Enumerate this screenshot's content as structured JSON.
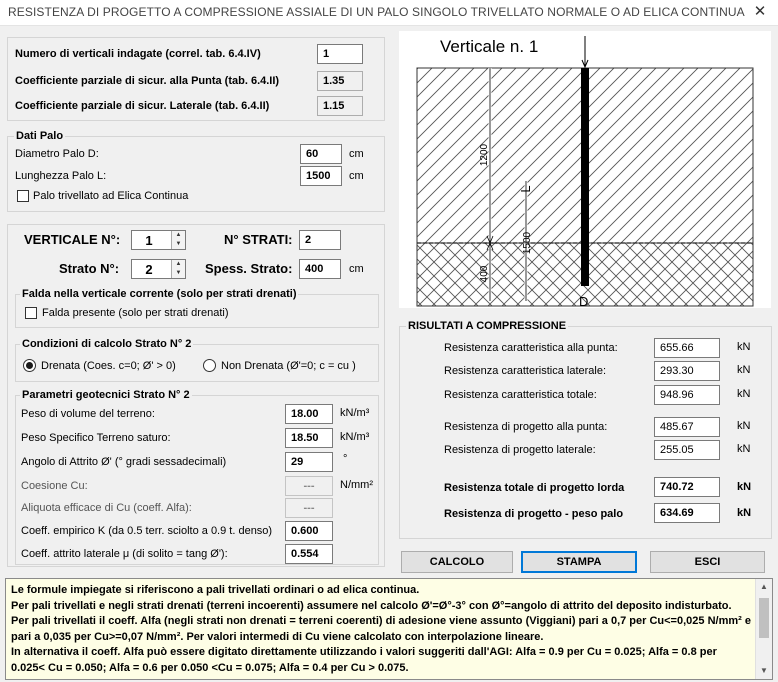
{
  "window": {
    "title": "RESISTENZA DI PROGETTO A COMPRESSIONE ASSIALE DI UN PALO SINGOLO TRIVELLATO NORMALE O AD ELICA CONTINUA",
    "close_glyph": "✕"
  },
  "general": {
    "n_verticali_label": "Numero di verticali indagate (correl. tab. 6.4.IV)",
    "n_verticali_value": "1",
    "coeff_punta_label": "Coefficiente parziale di sicur. alla Punta (tab. 6.4.II)",
    "coeff_punta_value": "1.35",
    "coeff_lat_label": "Coefficiente parziale di sicur.  Laterale (tab. 6.4.II)",
    "coeff_lat_value": "1.15"
  },
  "dati_palo": {
    "title": "Dati  Palo",
    "diametro_label": "Diametro Palo   D:",
    "diametro_value": "60",
    "diametro_unit": "cm",
    "lunghezza_label": "Lunghezza Palo   L:",
    "lunghezza_value": "1500",
    "lunghezza_unit": "cm",
    "elica_label": "Palo trivellato ad Elica Continua"
  },
  "strati": {
    "verticale_label": "VERTICALE  N°:",
    "verticale_value": "1",
    "n_strati_label": "N° STRATI:",
    "n_strati_value": "2",
    "strato_label": "Strato N°:",
    "strato_value": "2",
    "spess_label": "Spess. Strato:",
    "spess_value": "400",
    "spess_unit": "cm"
  },
  "falda": {
    "title": "Falda nella verticale corrente (solo per strati drenati)",
    "label": "Falda presente (solo per strati drenati)"
  },
  "condizioni": {
    "title": "Condizioni di calcolo Strato N° 2",
    "drenata_label": "Drenata    (Coes. c=0;  Ø' > 0)",
    "non_drenata_label": "Non Drenata  (Ø'=0;   c = cu )"
  },
  "parametri": {
    "title": "Parametri geotecnici Strato N° 2",
    "rows": [
      {
        "label": "Peso di volume del terreno:",
        "value": "18.00",
        "unit": "kN/m³"
      },
      {
        "label": "Peso Specifico Terreno saturo:",
        "value": "18.50",
        "unit": "kN/m³"
      },
      {
        "label": "Angolo di Attrito  Ø'    (° gradi sessadecimali)",
        "value": "29",
        "unit": "°"
      },
      {
        "label": "Coesione Cu:",
        "value": "---",
        "unit": "N/mm²"
      },
      {
        "label": "Aliquota efficace di Cu (coeff. Alfa):",
        "value": "---",
        "unit": ""
      },
      {
        "label": "Coeff. empirico K  (da 0.5 terr. sciolto a 0.9 t. denso)",
        "value": "0.600",
        "unit": ""
      },
      {
        "label": "Coeff. attrito laterale  μ  (di solito = tang Ø'):",
        "value": "0.554",
        "unit": ""
      }
    ]
  },
  "diagram": {
    "title": "Verticale n.  1",
    "dim_1200": "1200",
    "dim_400": "400",
    "dim_1500": "1500",
    "label_L": "L",
    "label_D": "D"
  },
  "risultati": {
    "title": "RISULTATI A COMPRESSIONE",
    "rows": [
      {
        "label": "Resistenza caratteristica alla punta:",
        "value": "655.66",
        "unit": "kN"
      },
      {
        "label": "Resistenza caratteristica laterale:",
        "value": "293.30",
        "unit": "kN"
      },
      {
        "label": "Resistenza caratteristica totale:",
        "value": "948.96",
        "unit": "kN"
      },
      {
        "label": "Resistenza di progetto alla punta:",
        "value": "485.67",
        "unit": "kN"
      },
      {
        "label": "Resistenza di progetto laterale:",
        "value": "255.05",
        "unit": "kN"
      },
      {
        "label": "Resistenza totale di progetto lorda",
        "value": "740.72",
        "unit": "kN"
      },
      {
        "label": "Resistenza di progetto - peso palo",
        "value": "634.69",
        "unit": "kN"
      }
    ]
  },
  "buttons": {
    "calcolo": "CALCOLO",
    "stampa": "STAMPA",
    "esci": "ESCI"
  },
  "notes": [
    "Le formule impiegate si riferiscono a pali trivellati ordinari o ad elica continua.",
    "Per pali trivellati e negli strati drenati (terreni incoerenti) assumere nel calcolo Ø'=Ø°-3°  con Ø°=angolo di attrito del deposito indisturbato.",
    "Per pali trivellati il coeff. Alfa (negli strati non drenati = terreni coerenti) di adesione viene assunto (Viggiani) pari a 0,7 per Cu<=0,025 N/mm² e pari a 0,035 per Cu>=0,07 N/mm². Per valori intermedi di Cu viene calcolato con interpolazione lineare.",
    "In alternativa il coeff. Alfa può essere digitato direttamente utilizzando i valori suggeriti dall'AGI: Alfa = 0.9 per Cu = 0.025; Alfa = 0.8 per 0.025< Cu = 0.050; Alfa = 0.6 per 0.050 <Cu = 0.075; Alfa = 0.4 per Cu > 0.075."
  ],
  "colors": {
    "background": "#f0f0f0",
    "notes_bg": "#fefee5",
    "focus": "#0078d7"
  }
}
